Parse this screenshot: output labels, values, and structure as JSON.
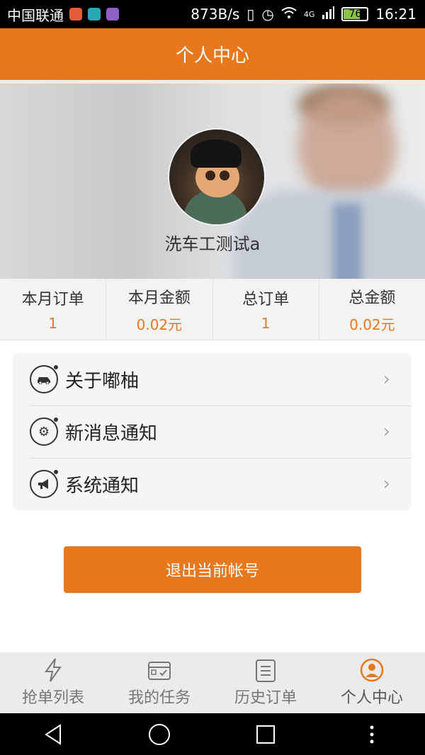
{
  "statusbar": {
    "carrier": "中国联通",
    "net_speed": "873B/s",
    "network_type": "4G",
    "battery": "76",
    "time": "16:21"
  },
  "header": {
    "title": "个人中心"
  },
  "profile": {
    "username": "洗车工测试a"
  },
  "stats": [
    {
      "label": "本月订单",
      "value": "1"
    },
    {
      "label": "本月金额",
      "value": "0.02元"
    },
    {
      "label": "总订单",
      "value": "1"
    },
    {
      "label": "总金额",
      "value": "0.02元"
    }
  ],
  "menu": [
    {
      "label": "关于嘟柚",
      "icon": "car-icon"
    },
    {
      "label": "新消息通知",
      "icon": "gear-icon"
    },
    {
      "label": "系统通知",
      "icon": "megaphone-icon"
    }
  ],
  "logout_label": "退出当前帐号",
  "tabs": [
    {
      "label": "抢单列表",
      "icon": "lightning-icon"
    },
    {
      "label": "我的任务",
      "icon": "calendar-check-icon"
    },
    {
      "label": "历史订单",
      "icon": "clipboard-icon"
    },
    {
      "label": "个人中心",
      "icon": "user-icon",
      "active": true
    }
  ],
  "colors": {
    "accent": "#e7781e"
  }
}
